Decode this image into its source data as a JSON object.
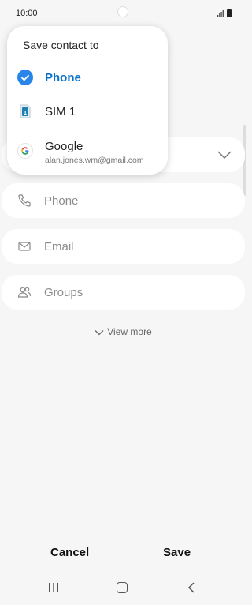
{
  "status_bar": {
    "time": "10:00"
  },
  "popup": {
    "title": "Save contact to",
    "items": [
      {
        "label": "Phone",
        "selected": true,
        "icon": "checkmark-circle-icon",
        "color": "#2a85e8"
      },
      {
        "label": "SIM 1",
        "selected": false,
        "icon": "sim-card-icon",
        "color": "#1e7fb0"
      },
      {
        "label": "Google",
        "sublabel": "alan.jones.wm@gmail.com",
        "selected": false,
        "icon": "google-icon"
      }
    ]
  },
  "form": {
    "fields": [
      {
        "label": "Phone",
        "icon": "phone-icon"
      },
      {
        "label": "Email",
        "icon": "mail-icon"
      },
      {
        "label": "Groups",
        "icon": "groups-icon"
      }
    ],
    "view_more": "View more"
  },
  "actions": {
    "cancel": "Cancel",
    "save": "Save"
  },
  "colors": {
    "accent": "#0a71c8",
    "background": "#f6f6f6",
    "card": "#ffffff"
  }
}
